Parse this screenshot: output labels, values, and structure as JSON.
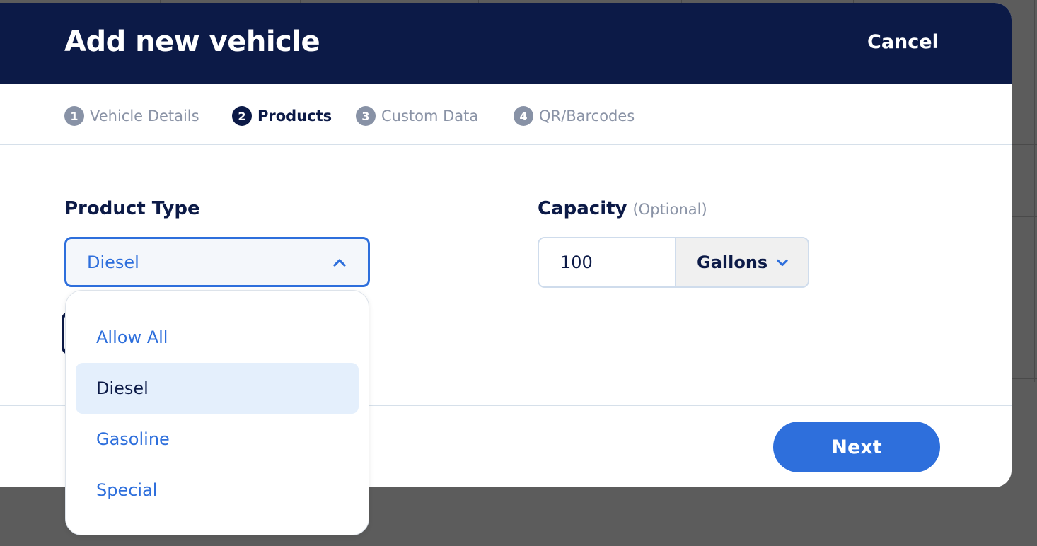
{
  "modal": {
    "title": "Add new vehicle",
    "cancel_label": "Cancel"
  },
  "steps": [
    {
      "number": "1",
      "label": "Vehicle Details",
      "active": false
    },
    {
      "number": "2",
      "label": "Products",
      "active": true
    },
    {
      "number": "3",
      "label": "Custom Data",
      "active": false
    },
    {
      "number": "4",
      "label": "QR/Barcodes",
      "active": false
    }
  ],
  "product_type": {
    "label": "Product Type",
    "selected": "Diesel",
    "options": [
      "Allow All",
      "Diesel",
      "Gasoline",
      "Special"
    ]
  },
  "capacity": {
    "label": "Capacity",
    "optional_label": "(Optional)",
    "value": "100",
    "unit": "Gallons"
  },
  "footer": {
    "next_label": "Next"
  },
  "colors": {
    "header_bg": "#0c1a47",
    "accent": "#2e6fdc",
    "selected_option_bg": "#e4effc",
    "overlay": "#5c5c5c"
  },
  "icons": {
    "product_type_toggle": "chevron-up-icon",
    "unit_toggle": "chevron-down-icon"
  }
}
